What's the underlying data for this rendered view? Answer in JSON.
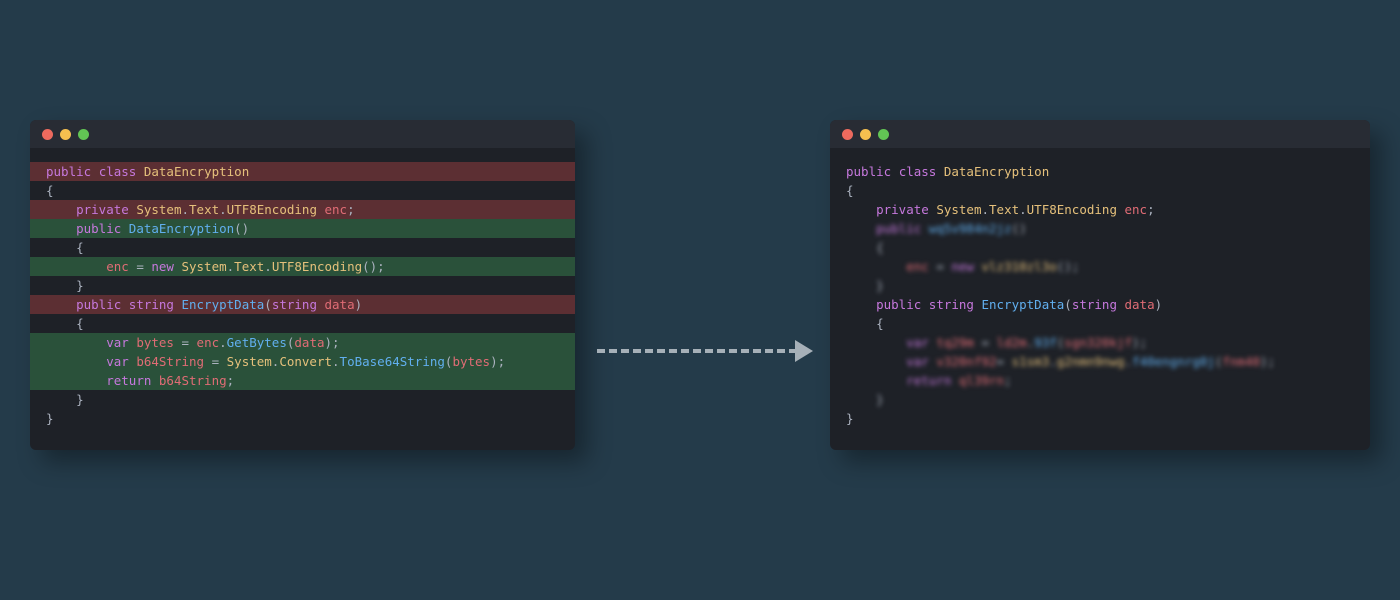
{
  "colors": {
    "window_bg": "#1e2127",
    "titlebar_bg": "#282c34",
    "highlight_red": "#5c2f33",
    "highlight_green": "#2a513a",
    "page_bg": "#243b4a"
  },
  "traffic_light": {
    "red": "#ed6a5e",
    "yellow": "#f5bf4f",
    "green": "#62c554"
  },
  "left": {
    "lines": [
      {
        "hl": "red",
        "tokens": [
          [
            "kw",
            "public"
          ],
          [
            "plain",
            " "
          ],
          [
            "kw",
            "class"
          ],
          [
            "plain",
            " "
          ],
          [
            "type",
            "DataEncryption"
          ]
        ]
      },
      {
        "tokens": [
          [
            "plain",
            "{"
          ]
        ]
      },
      {
        "hl": "red",
        "tokens": [
          [
            "plain",
            "    "
          ],
          [
            "kw",
            "private"
          ],
          [
            "plain",
            " "
          ],
          [
            "type",
            "System"
          ],
          [
            "plain",
            "."
          ],
          [
            "type",
            "Text"
          ],
          [
            "plain",
            "."
          ],
          [
            "type",
            "UTF8Encoding"
          ],
          [
            "plain",
            " "
          ],
          [
            "var",
            "enc"
          ],
          [
            "plain",
            ";"
          ]
        ]
      },
      {
        "tokens": [
          [
            "plain",
            ""
          ]
        ]
      },
      {
        "hl": "green",
        "tokens": [
          [
            "plain",
            "    "
          ],
          [
            "kw",
            "public"
          ],
          [
            "plain",
            " "
          ],
          [
            "fn",
            "DataEncryption"
          ],
          [
            "plain",
            "()"
          ]
        ]
      },
      {
        "tokens": [
          [
            "plain",
            "    {"
          ]
        ]
      },
      {
        "hl": "green",
        "tokens": [
          [
            "plain",
            "        "
          ],
          [
            "var",
            "enc"
          ],
          [
            "plain",
            " = "
          ],
          [
            "kw",
            "new"
          ],
          [
            "plain",
            " "
          ],
          [
            "type",
            "System"
          ],
          [
            "plain",
            "."
          ],
          [
            "type",
            "Text"
          ],
          [
            "plain",
            "."
          ],
          [
            "type",
            "UTF8Encoding"
          ],
          [
            "plain",
            "();"
          ]
        ]
      },
      {
        "tokens": [
          [
            "plain",
            "    }"
          ]
        ]
      },
      {
        "tokens": [
          [
            "plain",
            ""
          ]
        ]
      },
      {
        "hl": "red",
        "tokens": [
          [
            "plain",
            "    "
          ],
          [
            "kw",
            "public"
          ],
          [
            "plain",
            " "
          ],
          [
            "kw",
            "string"
          ],
          [
            "plain",
            " "
          ],
          [
            "fn",
            "EncryptData"
          ],
          [
            "plain",
            "("
          ],
          [
            "kw",
            "string"
          ],
          [
            "plain",
            " "
          ],
          [
            "var",
            "data"
          ],
          [
            "plain",
            ")"
          ]
        ]
      },
      {
        "tokens": [
          [
            "plain",
            "    {"
          ]
        ]
      },
      {
        "hl": "green",
        "tokens": [
          [
            "plain",
            "        "
          ],
          [
            "kw",
            "var"
          ],
          [
            "plain",
            " "
          ],
          [
            "var",
            "bytes"
          ],
          [
            "plain",
            " = "
          ],
          [
            "var",
            "enc"
          ],
          [
            "plain",
            "."
          ],
          [
            "fn",
            "GetBytes"
          ],
          [
            "plain",
            "("
          ],
          [
            "var",
            "data"
          ],
          [
            "plain",
            ");"
          ]
        ]
      },
      {
        "hl": "green",
        "tokens": [
          [
            "plain",
            "        "
          ],
          [
            "kw",
            "var"
          ],
          [
            "plain",
            " "
          ],
          [
            "var",
            "b64String"
          ],
          [
            "plain",
            " = "
          ],
          [
            "type",
            "System"
          ],
          [
            "plain",
            "."
          ],
          [
            "type",
            "Convert"
          ],
          [
            "plain",
            "."
          ],
          [
            "fn",
            "ToBase64String"
          ],
          [
            "plain",
            "("
          ],
          [
            "var",
            "bytes"
          ],
          [
            "plain",
            ");"
          ]
        ]
      },
      {
        "hl": "green",
        "tokens": [
          [
            "plain",
            "        "
          ],
          [
            "kw",
            "return"
          ],
          [
            "plain",
            " "
          ],
          [
            "var",
            "b64String"
          ],
          [
            "plain",
            ";"
          ]
        ]
      },
      {
        "tokens": [
          [
            "plain",
            "    }"
          ]
        ]
      },
      {
        "tokens": [
          [
            "plain",
            "}"
          ]
        ]
      }
    ]
  },
  "right": {
    "lines": [
      {
        "tokens": [
          [
            "kw",
            "public"
          ],
          [
            "plain",
            " "
          ],
          [
            "kw",
            "class"
          ],
          [
            "plain",
            " "
          ],
          [
            "type",
            "DataEncryption"
          ]
        ]
      },
      {
        "tokens": [
          [
            "plain",
            "{"
          ]
        ]
      },
      {
        "tokens": [
          [
            "plain",
            "    "
          ],
          [
            "kw",
            "private"
          ],
          [
            "plain",
            " "
          ],
          [
            "type",
            "System"
          ],
          [
            "plain",
            "."
          ],
          [
            "type",
            "Text"
          ],
          [
            "plain",
            "."
          ],
          [
            "type",
            "UTF8Encoding"
          ],
          [
            "plain",
            " "
          ],
          [
            "var",
            "enc"
          ],
          [
            "plain",
            ";"
          ]
        ]
      },
      {
        "tokens": [
          [
            "plain",
            ""
          ]
        ]
      },
      {
        "blur": true,
        "tokens": [
          [
            "plain",
            "    "
          ],
          [
            "kw",
            "public"
          ],
          [
            "plain",
            " "
          ],
          [
            "fn",
            "wq5v984n2jz"
          ],
          [
            "plain",
            "()"
          ]
        ]
      },
      {
        "blur": true,
        "tokens": [
          [
            "plain",
            "    {"
          ]
        ]
      },
      {
        "blur": true,
        "tokens": [
          [
            "plain",
            "        "
          ],
          [
            "var",
            "enc"
          ],
          [
            "plain",
            " = "
          ],
          [
            "kw",
            "new"
          ],
          [
            "plain",
            " "
          ],
          [
            "type",
            "vlz310zl3o"
          ],
          [
            "plain",
            "();"
          ]
        ]
      },
      {
        "blur": true,
        "tokens": [
          [
            "plain",
            "    }"
          ]
        ]
      },
      {
        "tokens": [
          [
            "plain",
            ""
          ]
        ]
      },
      {
        "tokens": [
          [
            "plain",
            "    "
          ],
          [
            "kw",
            "public"
          ],
          [
            "plain",
            " "
          ],
          [
            "kw",
            "string"
          ],
          [
            "plain",
            " "
          ],
          [
            "fn",
            "EncryptData"
          ],
          [
            "plain",
            "("
          ],
          [
            "kw",
            "string"
          ],
          [
            "plain",
            " "
          ],
          [
            "var",
            "data"
          ],
          [
            "plain",
            ")"
          ]
        ]
      },
      {
        "tokens": [
          [
            "plain",
            "    {"
          ]
        ]
      },
      {
        "blur": true,
        "tokens": [
          [
            "plain",
            "        "
          ],
          [
            "kw",
            "var"
          ],
          [
            "plain",
            " "
          ],
          [
            "var",
            "tq29m"
          ],
          [
            "plain",
            " = "
          ],
          [
            "var",
            "ld2m"
          ],
          [
            "plain",
            "."
          ],
          [
            "fn",
            "93f"
          ],
          [
            "plain",
            "("
          ],
          [
            "var",
            "sgn320kjf"
          ],
          [
            "plain",
            ");"
          ]
        ]
      },
      {
        "blur": true,
        "tokens": [
          [
            "plain",
            "        "
          ],
          [
            "kw",
            "var"
          ],
          [
            "plain",
            " "
          ],
          [
            "var",
            "v320nf92"
          ],
          [
            "plain",
            "= "
          ],
          [
            "type",
            "s1sm3"
          ],
          [
            "plain",
            "."
          ],
          [
            "type",
            "g2nmn9nwg"
          ],
          [
            "plain",
            "."
          ],
          [
            "fn",
            "f40engnrg0j"
          ],
          [
            "plain",
            "("
          ],
          [
            "var",
            "fnm40"
          ],
          [
            "plain",
            ");"
          ]
        ]
      },
      {
        "blur": true,
        "tokens": [
          [
            "plain",
            "        "
          ],
          [
            "kw",
            "return"
          ],
          [
            "plain",
            " "
          ],
          [
            "var",
            "ql39rn"
          ],
          [
            "plain",
            ";"
          ]
        ]
      },
      {
        "blur": true,
        "tokens": [
          [
            "plain",
            "    }"
          ]
        ]
      },
      {
        "tokens": [
          [
            "plain",
            "}"
          ]
        ]
      }
    ]
  }
}
